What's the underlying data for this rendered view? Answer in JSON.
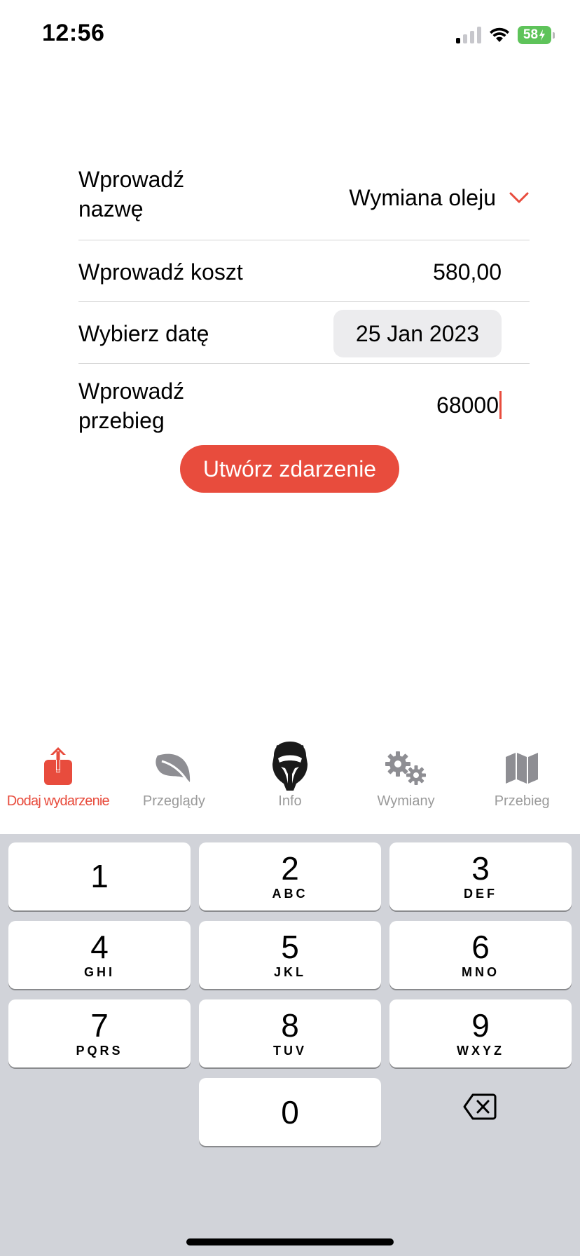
{
  "status_bar": {
    "time": "12:56",
    "battery": "58",
    "icons": [
      "signal-icon",
      "wifi-icon",
      "battery-icon"
    ]
  },
  "form": {
    "name_label": "Wprowadź nazwę",
    "name_value": "Wymiana oleju",
    "cost_label": "Wprowadź koszt",
    "cost_value": "580,00",
    "date_label": "Wybierz datę",
    "date_value": "25 Jan 2023",
    "mileage_label": "Wprowadź przebieg",
    "mileage_value": "68000"
  },
  "create_button": "Utwórz zdarzenie",
  "tabs": [
    {
      "label": "Dodaj wydarzenie",
      "icon": "share-upload-icon",
      "active": true
    },
    {
      "label": "Przeglądy",
      "icon": "leaf-icon",
      "active": false
    },
    {
      "label": "Info",
      "icon": "motorcycle-logo-icon",
      "active": false
    },
    {
      "label": "Wymiany",
      "icon": "gears-icon",
      "active": false
    },
    {
      "label": "Przebieg",
      "icon": "map-icon",
      "active": false
    }
  ],
  "keypad": {
    "k1": {
      "digit": "1",
      "letters": ""
    },
    "k2": {
      "digit": "2",
      "letters": "ABC"
    },
    "k3": {
      "digit": "3",
      "letters": "DEF"
    },
    "k4": {
      "digit": "4",
      "letters": "GHI"
    },
    "k5": {
      "digit": "5",
      "letters": "JKL"
    },
    "k6": {
      "digit": "6",
      "letters": "MNO"
    },
    "k7": {
      "digit": "7",
      "letters": "PQRS"
    },
    "k8": {
      "digit": "8",
      "letters": "TUV"
    },
    "k9": {
      "digit": "9",
      "letters": "WXYZ"
    },
    "k0": {
      "digit": "0",
      "letters": ""
    }
  },
  "colors": {
    "accent": "#e84c3d",
    "inactive_tab": "#9a9a9a",
    "keyboard_bg": "#d1d3d9",
    "battery": "#5ec35a"
  }
}
